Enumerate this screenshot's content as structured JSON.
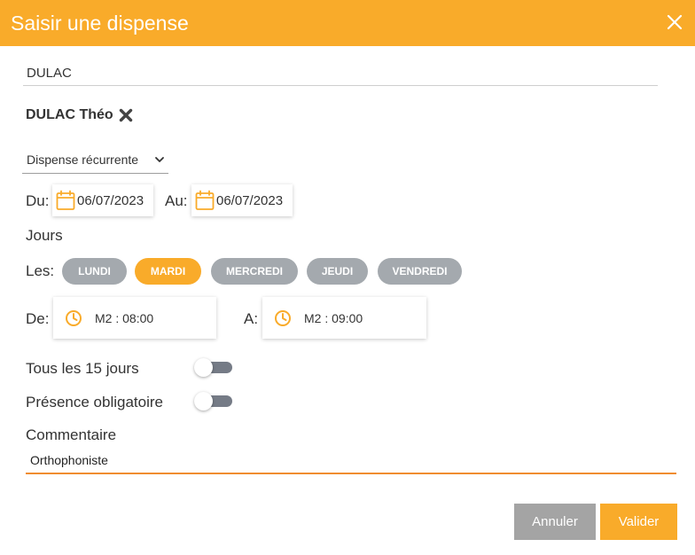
{
  "dialog": {
    "title": "Saisir une dispense",
    "close_icon": "close-icon"
  },
  "search": {
    "value": "DULAC"
  },
  "student": {
    "name": "DULAC Théo",
    "remove_icon": "remove-x-icon"
  },
  "type_select": {
    "value": "Dispense récurrente",
    "icon": "chevron-down-icon"
  },
  "dates": {
    "from_label": "Du:",
    "from_value": "06/07/2023",
    "to_label": "Au:",
    "to_value": "06/07/2023",
    "icon": "calendar-icon"
  },
  "days": {
    "heading": "Jours",
    "label": "Les:",
    "items": [
      {
        "label": "LUNDI",
        "selected": false
      },
      {
        "label": "MARDI",
        "selected": true
      },
      {
        "label": "MERCREDI",
        "selected": false
      },
      {
        "label": "JEUDI",
        "selected": false
      },
      {
        "label": "VENDREDI",
        "selected": false
      }
    ]
  },
  "times": {
    "from_label": "De:",
    "from_value": "M2 : 08:00",
    "to_label": "A:",
    "to_value": "M2 : 09:00",
    "icon": "clock-icon"
  },
  "options": {
    "biweekly_label": "Tous les 15 jours",
    "biweekly_on": false,
    "attendance_label": "Présence obligatoire",
    "attendance_on": false
  },
  "comment": {
    "label": "Commentaire",
    "value": "Orthophoniste"
  },
  "actions": {
    "cancel_label": "Annuler",
    "ok_label": "Valider"
  },
  "colors": {
    "accent": "#f9ab2a",
    "pill_inactive": "#a4a9ae",
    "cancel": "#a4a4a4",
    "comment_underline": "#f08c2f"
  }
}
